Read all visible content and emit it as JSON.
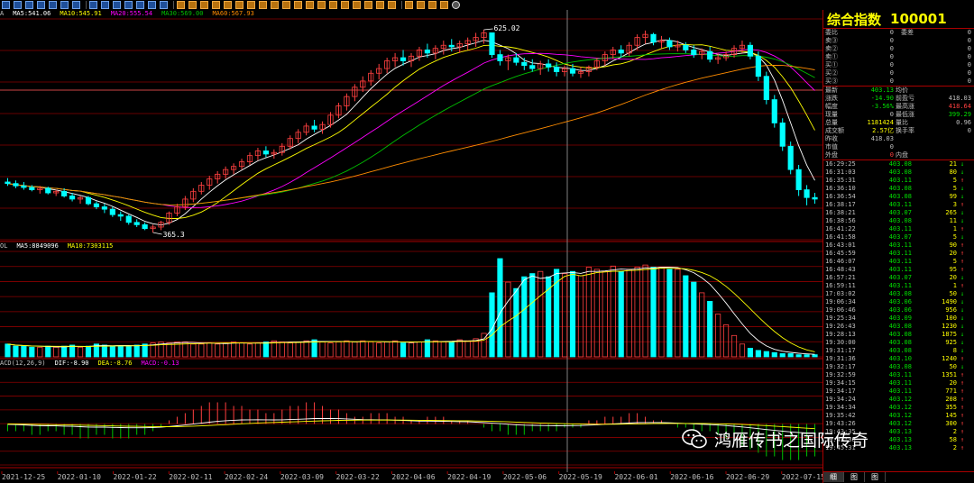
{
  "colors": {
    "up": "#ff4040",
    "down": "#00ffff",
    "grid": "#8b0000",
    "ma5": "#ffffff",
    "ma10": "#ffff00",
    "ma20": "#ff00ff",
    "ma30": "#00c000",
    "ma60": "#ff8c00"
  },
  "price_legend": [
    {
      "text": "A",
      "color": "#c0c0c0"
    },
    {
      "text": "MA5:541.06",
      "color": "#ffffff"
    },
    {
      "text": "MA10:545.91",
      "color": "#ffff00"
    },
    {
      "text": "MA20:555.54",
      "color": "#ff00ff"
    },
    {
      "text": "MA30:569.00",
      "color": "#00c000"
    },
    {
      "text": "MA60:567.93",
      "color": "#ff8c00"
    }
  ],
  "volume_legend": [
    {
      "text": "OL",
      "color": "#c0c0c0"
    },
    {
      "text": "MA5:8849096",
      "color": "#ffffff"
    },
    {
      "text": "MA10:7303115",
      "color": "#ffff00"
    }
  ],
  "macd_legend": [
    {
      "text": "ACD(12,26,9)",
      "color": "#c0c0c0"
    },
    {
      "text": "DIF:-8.90",
      "color": "#ffffff"
    },
    {
      "text": "DEA:-8.76",
      "color": "#ffff00"
    },
    {
      "text": "MACD:-0.13",
      "color": "#ff00ff"
    }
  ],
  "chart_data": {
    "type": "candlestick",
    "high_label": "625.02",
    "low_label": "365.3",
    "x_labels": [
      "2021-12-25",
      "2022-01-10",
      "2022-01-22",
      "2022-02-11",
      "2022-02-24",
      "2022-03-09",
      "2022-03-22",
      "2022-04-06",
      "2022-04-19",
      "2022-05-06",
      "2022-05-19",
      "2022-06-01",
      "2022-06-16",
      "2022-06-29",
      "2022-07-15"
    ],
    "ohlc": [
      [
        430,
        435,
        425,
        428
      ],
      [
        428,
        432,
        422,
        425
      ],
      [
        425,
        430,
        420,
        423
      ],
      [
        423,
        426,
        418,
        420
      ],
      [
        420,
        425,
        415,
        422
      ],
      [
        422,
        424,
        414,
        416
      ],
      [
        416,
        420,
        412,
        418
      ],
      [
        418,
        422,
        410,
        412
      ],
      [
        412,
        416,
        405,
        408
      ],
      [
        408,
        412,
        402,
        410
      ],
      [
        410,
        412,
        400,
        402
      ],
      [
        402,
        405,
        395,
        398
      ],
      [
        398,
        402,
        390,
        395
      ],
      [
        395,
        398,
        385,
        388
      ],
      [
        388,
        392,
        380,
        386
      ],
      [
        386,
        388,
        375,
        378
      ],
      [
        378,
        382,
        372,
        375
      ],
      [
        375,
        378,
        368,
        370
      ],
      [
        370,
        375,
        365,
        372
      ],
      [
        372,
        380,
        368,
        378
      ],
      [
        378,
        392,
        375,
        390
      ],
      [
        390,
        402,
        386,
        398
      ],
      [
        398,
        412,
        394,
        408
      ],
      [
        408,
        422,
        404,
        418
      ],
      [
        418,
        430,
        414,
        426
      ],
      [
        426,
        438,
        420,
        434
      ],
      [
        434,
        444,
        428,
        440
      ],
      [
        440,
        450,
        434,
        446
      ],
      [
        446,
        454,
        440,
        450
      ],
      [
        450,
        460,
        446,
        456
      ],
      [
        456,
        468,
        452,
        464
      ],
      [
        464,
        474,
        458,
        470
      ],
      [
        470,
        476,
        462,
        466
      ],
      [
        466,
        472,
        460,
        468
      ],
      [
        468,
        480,
        464,
        476
      ],
      [
        476,
        490,
        472,
        486
      ],
      [
        486,
        498,
        480,
        494
      ],
      [
        494,
        506,
        490,
        502
      ],
      [
        502,
        510,
        494,
        498
      ],
      [
        498,
        508,
        492,
        504
      ],
      [
        504,
        520,
        500,
        516
      ],
      [
        516,
        532,
        512,
        528
      ],
      [
        528,
        544,
        522,
        540
      ],
      [
        540,
        556,
        534,
        552
      ],
      [
        552,
        566,
        546,
        560
      ],
      [
        560,
        574,
        554,
        570
      ],
      [
        570,
        582,
        562,
        576
      ],
      [
        576,
        590,
        570,
        586
      ],
      [
        586,
        596,
        578,
        590
      ],
      [
        590,
        600,
        580,
        586
      ],
      [
        586,
        596,
        578,
        592
      ],
      [
        592,
        604,
        586,
        600
      ],
      [
        600,
        608,
        590,
        596
      ],
      [
        596,
        606,
        588,
        602
      ],
      [
        602,
        612,
        594,
        606
      ],
      [
        606,
        614,
        598,
        604
      ],
      [
        604,
        612,
        596,
        608
      ],
      [
        608,
        616,
        600,
        612
      ],
      [
        612,
        622,
        604,
        616
      ],
      [
        616,
        626,
        608,
        622
      ],
      [
        622,
        618,
        590,
        594
      ],
      [
        594,
        600,
        580,
        586
      ],
      [
        586,
        594,
        574,
        590
      ],
      [
        590,
        596,
        580,
        584
      ],
      [
        584,
        590,
        574,
        580
      ],
      [
        580,
        588,
        572,
        576
      ],
      [
        576,
        586,
        568,
        582
      ],
      [
        582,
        588,
        572,
        578
      ],
      [
        578,
        584,
        566,
        572
      ],
      [
        572,
        580,
        566,
        576
      ],
      [
        576,
        582,
        566,
        570
      ],
      [
        570,
        578,
        564,
        572
      ],
      [
        572,
        580,
        566,
        578
      ],
      [
        578,
        590,
        574,
        586
      ],
      [
        586,
        598,
        580,
        594
      ],
      [
        594,
        604,
        588,
        600
      ],
      [
        600,
        606,
        590,
        596
      ],
      [
        596,
        610,
        592,
        606
      ],
      [
        606,
        620,
        600,
        616
      ],
      [
        616,
        625,
        608,
        620
      ],
      [
        620,
        622,
        606,
        610
      ],
      [
        610,
        618,
        602,
        612
      ],
      [
        612,
        616,
        600,
        604
      ],
      [
        604,
        612,
        598,
        606
      ],
      [
        606,
        610,
        596,
        600
      ],
      [
        600,
        606,
        590,
        594
      ],
      [
        594,
        602,
        588,
        598
      ],
      [
        598,
        604,
        584,
        588
      ],
      [
        588,
        596,
        582,
        590
      ],
      [
        590,
        598,
        586,
        594
      ],
      [
        594,
        606,
        590,
        602
      ],
      [
        602,
        612,
        596,
        606
      ],
      [
        606,
        610,
        588,
        592
      ],
      [
        592,
        598,
        560,
        566
      ],
      [
        566,
        572,
        530,
        536
      ],
      [
        536,
        542,
        500,
        506
      ],
      [
        506,
        512,
        470,
        476
      ],
      [
        476,
        482,
        440,
        446
      ],
      [
        446,
        452,
        412,
        420
      ],
      [
        420,
        426,
        400,
        410
      ],
      [
        410,
        416,
        402,
        408
      ]
    ],
    "volume": [
      12,
      10,
      10,
      9,
      9,
      10,
      9,
      10,
      11,
      9,
      10,
      12,
      11,
      10,
      10,
      10,
      11,
      12,
      13,
      14,
      13,
      14,
      14,
      12,
      12,
      13,
      12,
      13,
      14,
      13,
      12,
      13,
      14,
      15,
      14,
      13,
      14,
      15,
      16,
      14,
      13,
      14,
      15,
      14,
      15,
      14,
      13,
      14,
      15,
      13,
      13,
      14,
      16,
      15,
      14,
      14,
      16,
      15,
      17,
      22,
      60,
      92,
      70,
      64,
      75,
      78,
      80,
      75,
      82,
      78,
      80,
      76,
      84,
      82,
      80,
      85,
      80,
      82,
      84,
      86,
      84,
      84,
      82,
      82,
      76,
      70,
      60,
      52,
      40,
      30,
      20,
      12,
      8,
      6,
      5,
      4,
      3,
      3,
      2,
      2,
      2
    ],
    "macd_hist": [
      -2,
      -2,
      -2,
      -3,
      -3,
      -2,
      -2,
      -3,
      -3,
      -4,
      -4,
      -3,
      -3,
      -4,
      -4,
      -4,
      -3,
      -3,
      -2,
      -1,
      1,
      2,
      3,
      4,
      5,
      6,
      6,
      6,
      5,
      5,
      4,
      4,
      3,
      3,
      4,
      5,
      5,
      6,
      6,
      5,
      4,
      4,
      3,
      2,
      2,
      3,
      3,
      3,
      2,
      2,
      1,
      1,
      2,
      2,
      2,
      1,
      1,
      1,
      0,
      -1,
      -2,
      -2,
      -3,
      -3,
      -3,
      -2,
      -2,
      -2,
      -2,
      -1,
      -1,
      -1,
      1,
      1,
      2,
      2,
      2,
      3,
      3,
      2,
      1,
      1,
      0,
      -1,
      -1,
      -2,
      -2,
      -2,
      -3,
      -4,
      -5,
      -6,
      -7,
      -8,
      -9,
      -9,
      -10,
      -10,
      -10,
      -9,
      -9
    ]
  },
  "panel": {
    "title": "综合指数",
    "code": "100001",
    "order_rows": [
      {
        "l1": "委比",
        "v1": "0",
        "l2": "委差",
        "v2": "0"
      },
      {
        "l1": "卖③",
        "v1": "0",
        "l2": "",
        "v2": "0"
      },
      {
        "l1": "卖②",
        "v1": "0",
        "l2": "",
        "v2": "0"
      },
      {
        "l1": "卖①",
        "v1": "0",
        "l2": "",
        "v2": "0"
      },
      {
        "l1": "买①",
        "v1": "0",
        "l2": "",
        "v2": "0"
      },
      {
        "l1": "买②",
        "v1": "0",
        "l2": "",
        "v2": "0"
      },
      {
        "l1": "买③",
        "v1": "0",
        "l2": "",
        "v2": "0"
      }
    ],
    "stats_rows": [
      {
        "l1": "最新",
        "v1": "403.13",
        "c1": "#00e000",
        "l2": "均价",
        "v2": "",
        "c2": "#c0c0c0"
      },
      {
        "l1": "涨跌",
        "v1": "-14.90",
        "c1": "#00e000",
        "l2": "前盈亏",
        "v2": "418.03",
        "c2": "#c0c0c0"
      },
      {
        "l1": "幅度",
        "v1": "-3.56%",
        "c1": "#00e000",
        "l2": "最高涨",
        "v2": "418.64",
        "c2": "#ff4040"
      },
      {
        "l1": "现量",
        "v1": "0",
        "c1": "#c0c0c0",
        "l2": "最低涨",
        "v2": "399.29",
        "c2": "#00e000"
      },
      {
        "l1": "总量",
        "v1": "1181424",
        "c1": "#ffff00",
        "l2": "量比",
        "v2": "0.96",
        "c2": "#c0c0c0"
      },
      {
        "l1": "成交额",
        "v1": "2.57亿",
        "c1": "#ffff00",
        "l2": "换手率",
        "v2": "0",
        "c2": "#c0c0c0"
      },
      {
        "l1": "昨收",
        "v1": "418.03",
        "c1": "#c0c0c0",
        "l2": "",
        "v2": "",
        "c2": "#c0c0c0"
      },
      {
        "l1": "市值",
        "v1": "0",
        "c1": "#c0c0c0",
        "l2": "",
        "v2": "",
        "c2": "#c0c0c0"
      },
      {
        "l1": "外盘",
        "v1": "0",
        "c1": "#ff4040",
        "l2": "内盘",
        "v2": "",
        "c2": "#00e000"
      }
    ],
    "ticks": [
      [
        "16:29:25",
        "403.08",
        "21",
        "↓"
      ],
      [
        "16:31:03",
        "403.08",
        "80",
        "↓"
      ],
      [
        "16:35:31",
        "403.11",
        "5",
        "↑"
      ],
      [
        "16:36:10",
        "403.08",
        "5",
        "↓"
      ],
      [
        "16:36:54",
        "403.08",
        "99",
        "↓"
      ],
      [
        "16:38:17",
        "403.11",
        "3",
        "↑"
      ],
      [
        "16:38:21",
        "403.07",
        "265",
        "↓"
      ],
      [
        "16:38:56",
        "403.08",
        "11",
        "↓"
      ],
      [
        "16:41:22",
        "403.11",
        "1",
        "↑"
      ],
      [
        "16:41:58",
        "403.07",
        "5",
        "↓"
      ],
      [
        "16:43:01",
        "403.11",
        "90",
        "↑"
      ],
      [
        "16:45:59",
        "403.11",
        "20",
        "↑"
      ],
      [
        "16:46:07",
        "403.11",
        "5",
        "↑"
      ],
      [
        "16:48:43",
        "403.11",
        "95",
        "↑"
      ],
      [
        "16:57:21",
        "403.07",
        "20",
        "↓"
      ],
      [
        "16:59:11",
        "403.11",
        "1",
        "↑"
      ],
      [
        "17:03:02",
        "403.08",
        "50",
        "↓"
      ],
      [
        "19:06:34",
        "403.06",
        "1490",
        "↓"
      ],
      [
        "19:06:46",
        "403.06",
        "956",
        "↓"
      ],
      [
        "19:25:34",
        "403.09",
        "100",
        "↓"
      ],
      [
        "19:26:43",
        "403.08",
        "1230",
        "↓"
      ],
      [
        "19:28:13",
        "403.08",
        "1875",
        "↓"
      ],
      [
        "19:30:00",
        "403.08",
        "925",
        "↓"
      ],
      [
        "19:31:17",
        "403.08",
        "8",
        "↓"
      ],
      [
        "19:31:36",
        "403.10",
        "1240",
        "↑"
      ],
      [
        "19:32:17",
        "403.08",
        "50",
        "↓"
      ],
      [
        "19:32:59",
        "403.11",
        "1351",
        "↑"
      ],
      [
        "19:34:15",
        "403.11",
        "20",
        "↑"
      ],
      [
        "19:34:17",
        "403.11",
        "771",
        "↑"
      ],
      [
        "19:34:24",
        "403.12",
        "208",
        "↑"
      ],
      [
        "19:34:34",
        "403.12",
        "355",
        "↑"
      ],
      [
        "19:35:42",
        "403.12",
        "145",
        "↑"
      ],
      [
        "19:43:26",
        "403.12",
        "300",
        "↑"
      ],
      [
        "19:43:35",
        "403.13",
        "2",
        "↑"
      ],
      [
        "19:43:38",
        "403.13",
        "58",
        "↑"
      ],
      [
        "19:45:31",
        "403.13",
        "2",
        "↑"
      ]
    ],
    "tabs": [
      "细",
      "图",
      "图"
    ]
  },
  "watermark": "鸿雁传书之国际传奇"
}
